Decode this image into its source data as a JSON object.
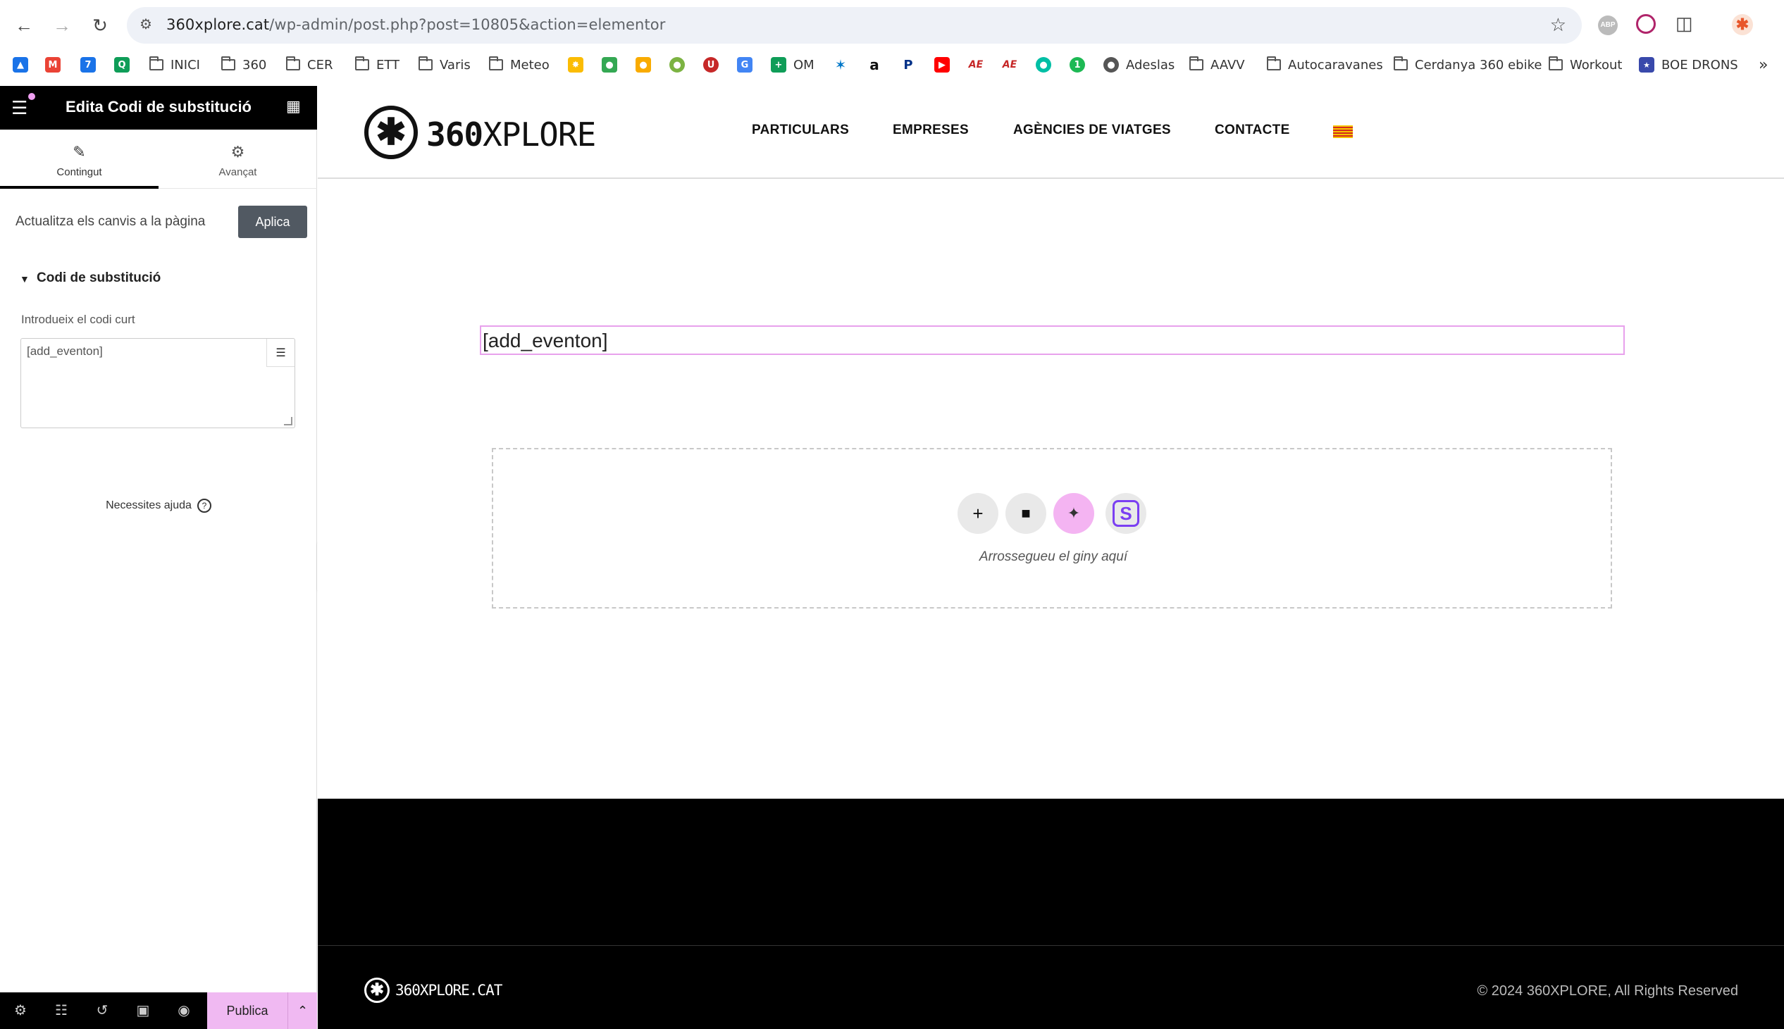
{
  "browser": {
    "url_host": "360xplore.cat",
    "url_path": "/wp-admin/post.php?post=10805&action=elementor",
    "bookmarks": [
      "INICI",
      "360",
      "CER",
      "ETT",
      "Varis",
      "Meteo",
      "OM",
      "Adeslas",
      "AAVV",
      "Autocaravanes",
      "Cerdanya 360 ebike",
      "Workout",
      "BOE DRONS"
    ]
  },
  "panel": {
    "title": "Edita Codi de substitució",
    "tabs": [
      {
        "label": "Contingut",
        "icon": "pencil-icon"
      },
      {
        "label": "Avançat",
        "icon": "gear-icon"
      }
    ],
    "apply_label": "Actualitza els canvis a la pàgina",
    "apply_button": "Aplica",
    "section_title": "Codi de substitució",
    "field_label": "Introdueix el codi curt",
    "field_value": "[add_eventon]",
    "help_text": "Necessites ajuda",
    "publish_button": "Publica"
  },
  "site": {
    "logo_bold": "360",
    "logo_light": "XPLORE",
    "nav": [
      "PARTICULARS",
      "EMPRESES",
      "AGÈNCIES DE VIATGES",
      "CONTACTE"
    ],
    "shortcode_text": "[add_eventon]",
    "drop_text": "Arrossegueu el giny aquí",
    "footer_logo": "360XPLORE.CAT",
    "copyright": "© 2024 360XPLORE, All Rights Reserved"
  },
  "colors": {
    "accent_pink": "#f0b9f2",
    "panel_dark": "#000000",
    "apply_button": "#515962"
  }
}
